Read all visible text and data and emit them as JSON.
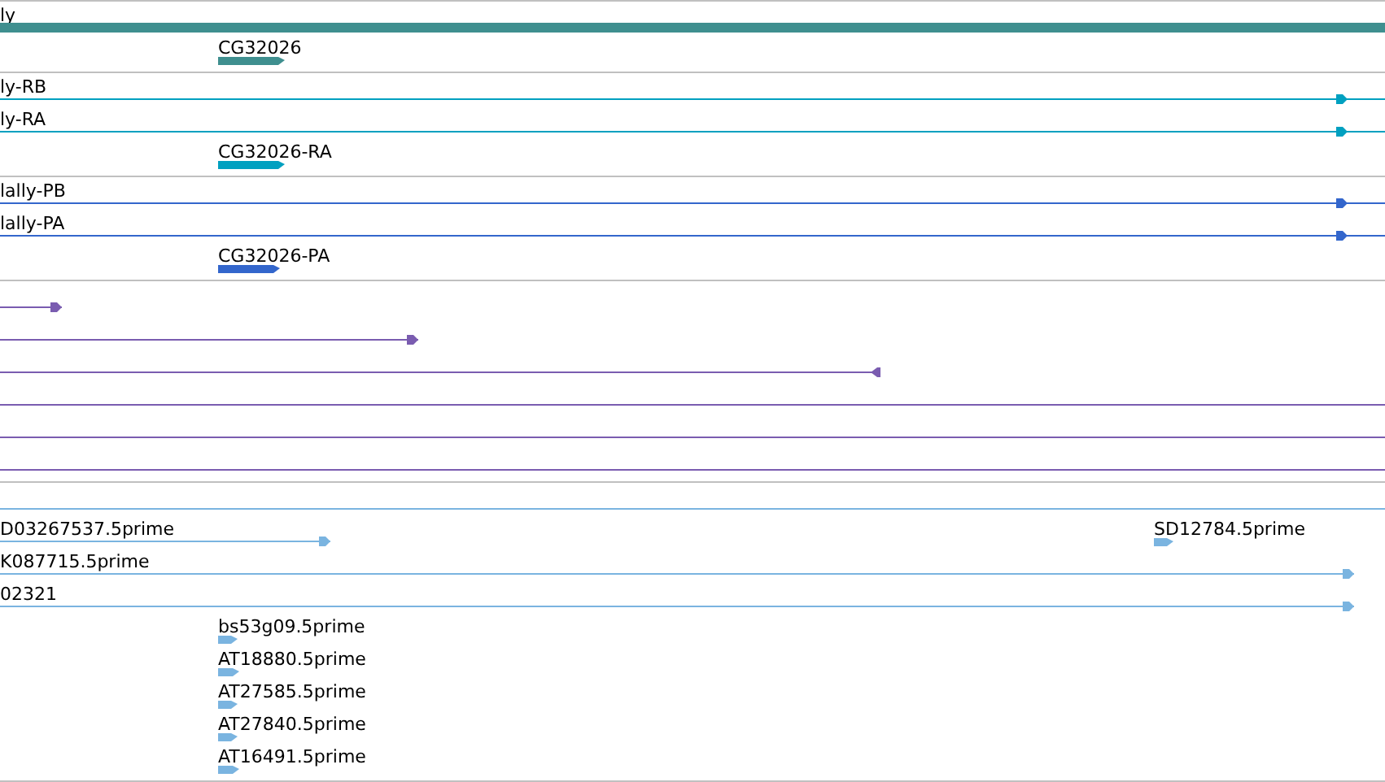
{
  "tracks": [
    {
      "color": "#3f8f8f",
      "rows": [
        {
          "features": [
            {
              "label": "ly",
              "kind": "thick"
            }
          ]
        },
        {
          "features": [
            {
              "label": "CG32026",
              "kind": "block",
              "reverse": false
            }
          ]
        }
      ]
    },
    {
      "color": "#00a0c0",
      "rows": [
        {
          "features": [
            {
              "label": "ly-RB",
              "kind": "arrow",
              "reverse": false
            }
          ]
        },
        {
          "features": [
            {
              "label": "ly-RA",
              "kind": "arrow",
              "reverse": false
            }
          ]
        },
        {
          "features": [
            {
              "label": "CG32026-RA",
              "kind": "block",
              "reverse": false
            }
          ]
        }
      ]
    },
    {
      "color": "#3366cc",
      "rows": [
        {
          "features": [
            {
              "label": "lally-PB",
              "kind": "arrow",
              "reverse": false
            }
          ]
        },
        {
          "features": [
            {
              "label": "lally-PA",
              "kind": "arrow",
              "reverse": false
            }
          ]
        },
        {
          "features": [
            {
              "label": "CG32026-PA",
              "kind": "block",
              "reverse": false
            }
          ]
        }
      ]
    },
    {
      "color": "#7a5cb0",
      "rows": [
        {
          "features": [
            {
              "kind": "arrow",
              "reverse": false
            }
          ]
        },
        {
          "features": [
            {
              "kind": "arrow",
              "reverse": false
            }
          ]
        },
        {
          "features": [
            {
              "kind": "arrow",
              "reverse": true
            }
          ]
        },
        {
          "features": [
            {
              "kind": "line"
            }
          ]
        },
        {
          "features": [
            {
              "kind": "line"
            }
          ]
        },
        {
          "features": [
            {
              "kind": "line"
            }
          ]
        }
      ]
    },
    {
      "color": "#7ab4e0",
      "rows": [
        {
          "features": [
            {
              "kind": "line"
            }
          ]
        },
        {
          "features": [
            {
              "label": "D03267537.5prime",
              "kind": "arrow",
              "reverse": false
            },
            {
              "label": "SD12784.5prime",
              "kind": "block",
              "reverse": false
            }
          ]
        },
        {
          "features": [
            {
              "label": "K087715.5prime",
              "kind": "arrow",
              "reverse": false
            }
          ]
        },
        {
          "features": [
            {
              "label": "02321",
              "kind": "arrow",
              "reverse": false
            }
          ]
        },
        {
          "features": [
            {
              "label": "bs53g09.5prime",
              "kind": "block",
              "reverse": false
            }
          ]
        },
        {
          "features": [
            {
              "label": "AT18880.5prime",
              "kind": "block",
              "reverse": false
            }
          ]
        },
        {
          "features": [
            {
              "label": "AT27585.5prime",
              "kind": "block",
              "reverse": false
            }
          ]
        },
        {
          "features": [
            {
              "label": "AT27840.5prime",
              "kind": "block",
              "reverse": false
            }
          ]
        },
        {
          "features": [
            {
              "label": "AT16491.5prime",
              "kind": "block",
              "reverse": false
            }
          ]
        }
      ]
    }
  ]
}
